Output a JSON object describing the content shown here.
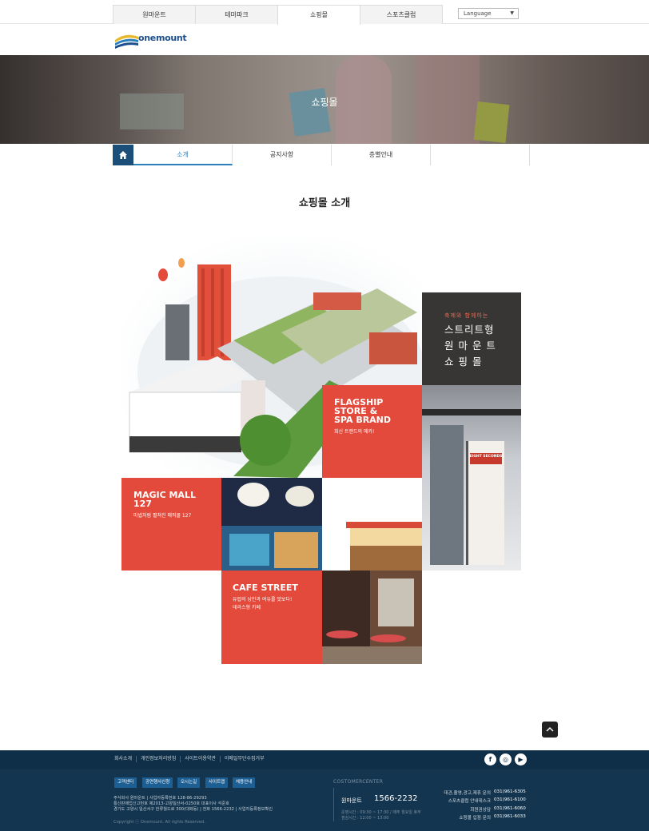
{
  "top_nav": {
    "tabs": [
      "원마운트",
      "테마파크",
      "쇼핑몰",
      "스포츠클럽"
    ],
    "active_index": 2,
    "language_label": "Language"
  },
  "logo": {
    "text": "onemount"
  },
  "hero": {
    "title": "쇼핑몰"
  },
  "sub_nav": {
    "items": [
      "소개",
      "공지사항",
      "층별안내",
      ""
    ],
    "active_index": 0
  },
  "page_title": "쇼핑몰 소개",
  "collage": {
    "street": {
      "eyebrow": "축제와 함께하는",
      "lines": [
        "스트리트형",
        "원 마 운 트",
        "쇼 핑 몰"
      ]
    },
    "flagship": {
      "title_lines": [
        "FLAGSHIP",
        "STORE &",
        "SPA BRAND"
      ],
      "sub": "최신 트랜드의 메카!"
    },
    "magic_mall": {
      "title_lines": [
        "MAGIC MALL",
        "127"
      ],
      "sub": "마법처럼 펼쳐진 매직몰 127"
    },
    "cafe_street": {
      "title": "CAFE STREET",
      "sub_lines": [
        "유럽의 낭만과 여유를 맛보다!",
        "테라스형 카페"
      ]
    },
    "store_sign": "EIGHT SECONDS"
  },
  "footer": {
    "links": [
      "회사소개",
      "개인정보처리방침",
      "사이트이용약관",
      "이메일무단수집거부"
    ],
    "social": [
      "facebook-icon",
      "instagram-icon",
      "youtube-icon"
    ],
    "buttons": [
      "고객센터",
      "공연행사신청",
      "오시는길",
      "사이트맵",
      "채용안내"
    ],
    "company_info": [
      "주식회사 원마운트 | 사업자등록번호 128-86-29293",
      "통신판매업신고번호 제2013-고양일산서-0250호 대표이사 석준호",
      "경기도 고양시 일산서구 한류월드로 300(대화동) | 전화 1566-2232 | 사업자등록정보확인"
    ],
    "copyright": "Copyright ⓒ Onemount. All rights Reserved.",
    "center_title": "COSTOMERCENTER",
    "center_name": "원마운트",
    "center_number": "1566-2232",
    "center_hours": [
      "운영시간 : 09:30 ~ 17:30 / 매주 월요일 휴무",
      "점심시간 : 12:00 ~ 13:00"
    ],
    "contacts": [
      {
        "label": "대관,촬영,광고,제휴 문의",
        "number": "031)961-6305"
      },
      {
        "label": "스포츠클럽 안내데스크",
        "number": "031)961-6100"
      },
      {
        "label": "회원권상담",
        "number": "031)961-6060"
      },
      {
        "label": "쇼핑몰 입점 문의",
        "number": "031)961-6033"
      }
    ]
  },
  "colors": {
    "accent_red": "#e34a3b",
    "nav_blue": "#1b4f7a",
    "footer_navy": "#13354f",
    "dark_tile": "#383634"
  }
}
